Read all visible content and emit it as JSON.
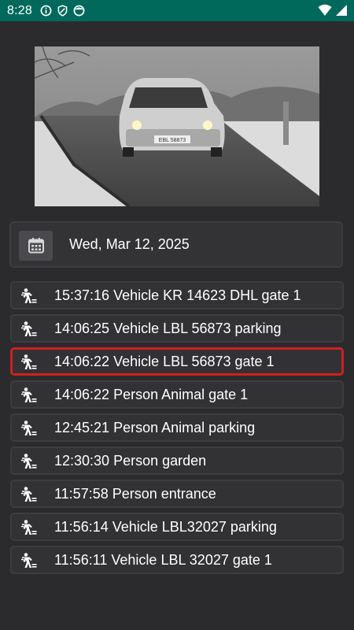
{
  "status_bar": {
    "time": "8:28",
    "left_icons": [
      "info-icon",
      "shield-icon",
      "face-icon"
    ],
    "right_icons": [
      "wifi-icon",
      "signal-icon"
    ],
    "background": "#00695c"
  },
  "camera_snapshot": {
    "plate_text": "EBL 58873"
  },
  "date_picker": {
    "icon": "calendar-icon",
    "date": "Wed, Mar 12, 2025"
  },
  "events": [
    {
      "text": "15:37:16 Vehicle KR 14623 DHL gate 1",
      "selected": false,
      "icon": "person-walking-icon"
    },
    {
      "text": "14:06:25 Vehicle LBL 56873 parking",
      "selected": false,
      "icon": "person-walking-icon"
    },
    {
      "text": "14:06:22 Vehicle LBL 56873 gate 1",
      "selected": true,
      "icon": "person-walking-icon"
    },
    {
      "text": "14:06:22 Person Animal gate 1",
      "selected": false,
      "icon": "person-walking-icon"
    },
    {
      "text": "12:45:21 Person Animal parking",
      "selected": false,
      "icon": "person-walking-icon"
    },
    {
      "text": "12:30:30 Person garden",
      "selected": false,
      "icon": "person-walking-icon"
    },
    {
      "text": "11:57:58 Person entrance",
      "selected": false,
      "icon": "person-walking-icon"
    },
    {
      "text": "11:56:14 Vehicle LBL32027 parking",
      "selected": false,
      "icon": "person-walking-icon"
    },
    {
      "text": "11:56:11 Vehicle LBL 32027 gate 1",
      "selected": false,
      "icon": "person-walking-icon"
    }
  ],
  "colors": {
    "background": "#2b2b2d",
    "selected_border": "#d0201e",
    "item_background": "#323235"
  }
}
